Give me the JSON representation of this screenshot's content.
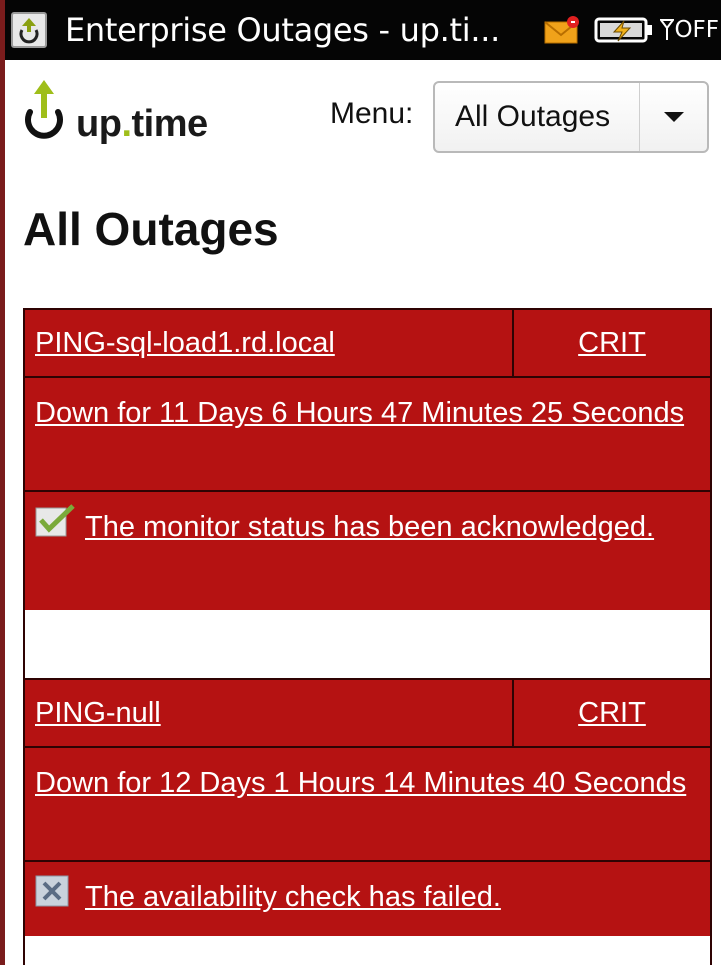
{
  "window": {
    "title": "Enterprise Outages - up.ti...",
    "signal": "OFF"
  },
  "header": {
    "logo_prefix": "up",
    "logo_dot": ".",
    "logo_suffix": "time",
    "menu_label": "Menu:",
    "menu_selected": "All Outages"
  },
  "page": {
    "title": "All Outages"
  },
  "outages": [
    {
      "name": "PING-sql-load1.rd.local",
      "status": "CRIT",
      "duration": "Down for 11 Days 6 Hours 47 Minutes 25 Seconds",
      "message": "The monitor status has been acknowledged.",
      "icon": "check-icon"
    },
    {
      "name": "PING-null",
      "status": "CRIT",
      "duration": "Down for 12 Days 1 Hours 14 Minutes 40 Seconds",
      "message": "The availability check has failed.",
      "icon": "x-icon"
    }
  ],
  "colors": {
    "outage_bg": "#b51212",
    "logo_accent": "#9fbe1a",
    "statusbar_bg": "#050505"
  }
}
